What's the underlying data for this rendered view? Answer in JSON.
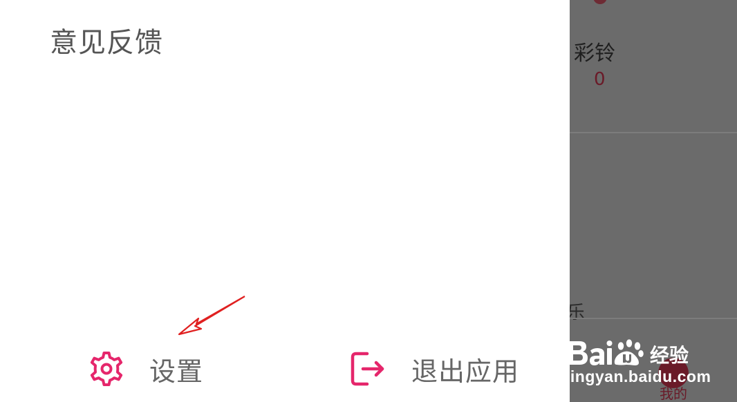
{
  "drawer": {
    "feedback_label": "意见反馈",
    "settings_label": "设置",
    "exit_label": "退出应用"
  },
  "background_page": {
    "stat_label": "彩铃",
    "stat_value": "0",
    "partial_text": "乐",
    "tab_label": "我的"
  },
  "watermark": {
    "logo_text": "Bai du 经验",
    "url": "jingyan.baidu.com"
  },
  "colors": {
    "accent": "#e5266b",
    "annotation_arrow": "#e02020",
    "scrim": "#6b6b6b",
    "menu_text": "#555555"
  },
  "icons": {
    "settings": "gear-icon",
    "exit": "exit-app-icon",
    "annotation": "annotation-arrow"
  }
}
